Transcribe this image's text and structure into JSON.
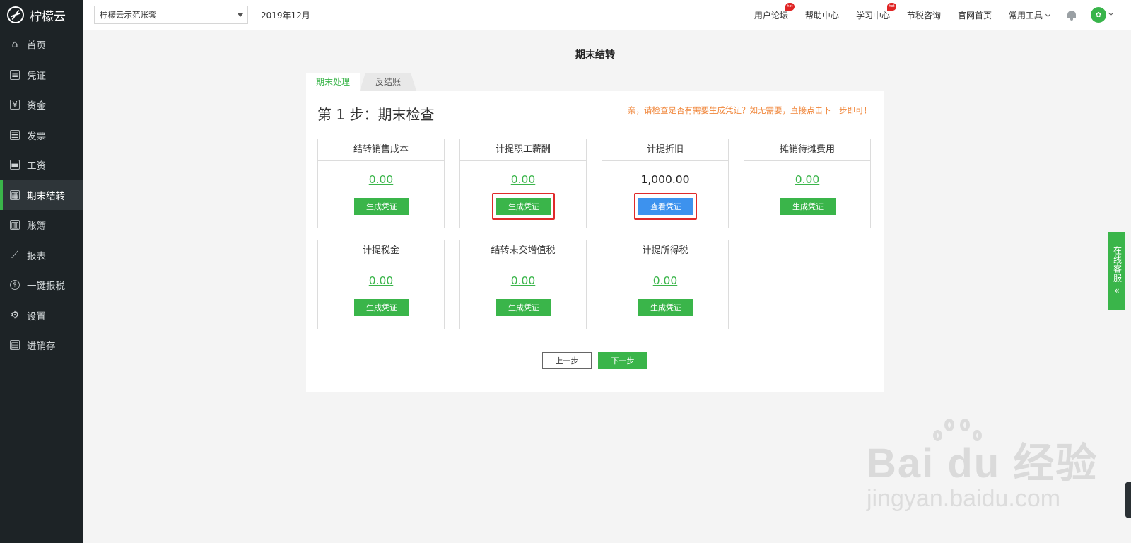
{
  "app": {
    "name": "柠檬云"
  },
  "sidebar": {
    "items": [
      {
        "label": "首页",
        "icon": "home-icon",
        "active": false
      },
      {
        "label": "凭证",
        "icon": "voucher-icon",
        "active": false
      },
      {
        "label": "资金",
        "icon": "fund-icon",
        "active": false
      },
      {
        "label": "发票",
        "icon": "invoice-icon",
        "active": false
      },
      {
        "label": "工资",
        "icon": "salary-icon",
        "active": false
      },
      {
        "label": "期末结转",
        "icon": "calendar-icon",
        "active": true
      },
      {
        "label": "账簿",
        "icon": "ledger-icon",
        "active": false
      },
      {
        "label": "报表",
        "icon": "chart-icon",
        "active": false
      },
      {
        "label": "一键报税",
        "icon": "tax-icon",
        "active": false
      },
      {
        "label": "设置",
        "icon": "gear-icon",
        "active": false
      },
      {
        "label": "进销存",
        "icon": "inventory-icon",
        "active": false
      }
    ]
  },
  "topbar": {
    "account": "柠檬云示范账套",
    "period": "2019年12月",
    "links": {
      "forum": "用户论坛",
      "help": "帮助中心",
      "learn": "学习中心",
      "tax": "节税咨询",
      "website": "官网首页",
      "tools": "常用工具"
    },
    "hot_badge": "hot"
  },
  "main": {
    "title": "期末结转",
    "tabs": {
      "active": "期末处理",
      "other": "反结账"
    },
    "step_title": "第 1 步：期末检查",
    "hint": "亲，请检查是否有需要生成凭证？如无需要，直接点击下一步即可！",
    "cards": [
      {
        "title": "结转销售成本",
        "amount": "0.00",
        "button": "生成凭证"
      },
      {
        "title": "计提职工薪酬",
        "amount": "0.00",
        "button": "生成凭证"
      },
      {
        "title": "计提折旧",
        "amount": "1,000.00",
        "button": "查看凭证"
      },
      {
        "title": "摊销待摊费用",
        "amount": "0.00",
        "button": "生成凭证"
      },
      {
        "title": "计提税金",
        "amount": "0.00",
        "button": "生成凭证"
      },
      {
        "title": "结转未交增值税",
        "amount": "0.00",
        "button": "生成凭证"
      },
      {
        "title": "计提所得税",
        "amount": "0.00",
        "button": "生成凭证"
      }
    ],
    "prev_button": "上一步",
    "next_button": "下一步"
  },
  "service": {
    "label": "在线客服",
    "arrow": "«"
  },
  "watermark": {
    "main": "Bai du 经验",
    "sub": "jingyan.baidu.com"
  },
  "colors": {
    "sidebar_bg": "#1d2326",
    "accent": "#3ab54a",
    "blue": "#3d92ee",
    "hint": "#f0863a",
    "highlight": "#e02a2a"
  }
}
